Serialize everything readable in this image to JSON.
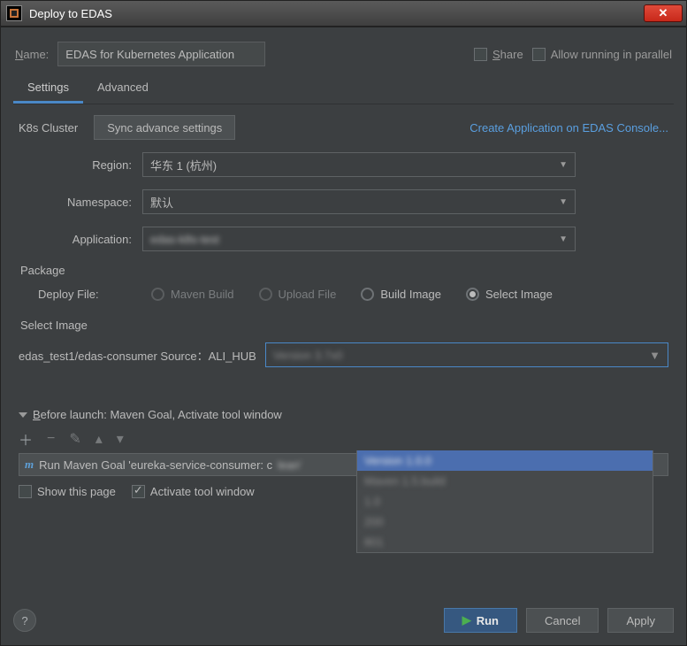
{
  "titlebar": {
    "title": "Deploy to EDAS"
  },
  "header": {
    "name_label": "Name:",
    "name_value": "EDAS for Kubernetes Application",
    "share_label": "Share",
    "parallel_label": "Allow running in parallel"
  },
  "tabs": {
    "settings": "Settings",
    "advanced": "Advanced"
  },
  "k8s": {
    "cluster_label": "K8s Cluster",
    "sync_btn": "Sync advance settings",
    "create_link": "Create Application on EDAS Console..."
  },
  "form": {
    "region_label": "Region:",
    "region_value": "华东 1 (杭州)",
    "namespace_label": "Namespace:",
    "namespace_value": "默认",
    "application_label": "Application:",
    "application_value": "edas-k8s-test"
  },
  "package": {
    "section": "Package",
    "deploy_file_label": "Deploy File:",
    "maven_build": "Maven Build",
    "upload_file": "Upload File",
    "build_image": "Build Image",
    "select_image": "Select Image"
  },
  "select_image": {
    "section": "Select Image",
    "prefix": "edas_test1/edas-consumer  Source：ALI_HUB",
    "current": "Version 3.7x0",
    "options": [
      "Version 1.0.0",
      "Maven 1.5.build",
      "1.0",
      "200",
      "801"
    ]
  },
  "before_launch": {
    "header": "Before launch: Maven Goal, Activate tool window",
    "maven_row": "Run Maven Goal 'eureka-service-consumer: c",
    "maven_row_suffix": "lean'",
    "show_page": "Show this page",
    "activate_tw": "Activate tool window"
  },
  "footer": {
    "run": "Run",
    "cancel": "Cancel",
    "apply": "Apply"
  }
}
